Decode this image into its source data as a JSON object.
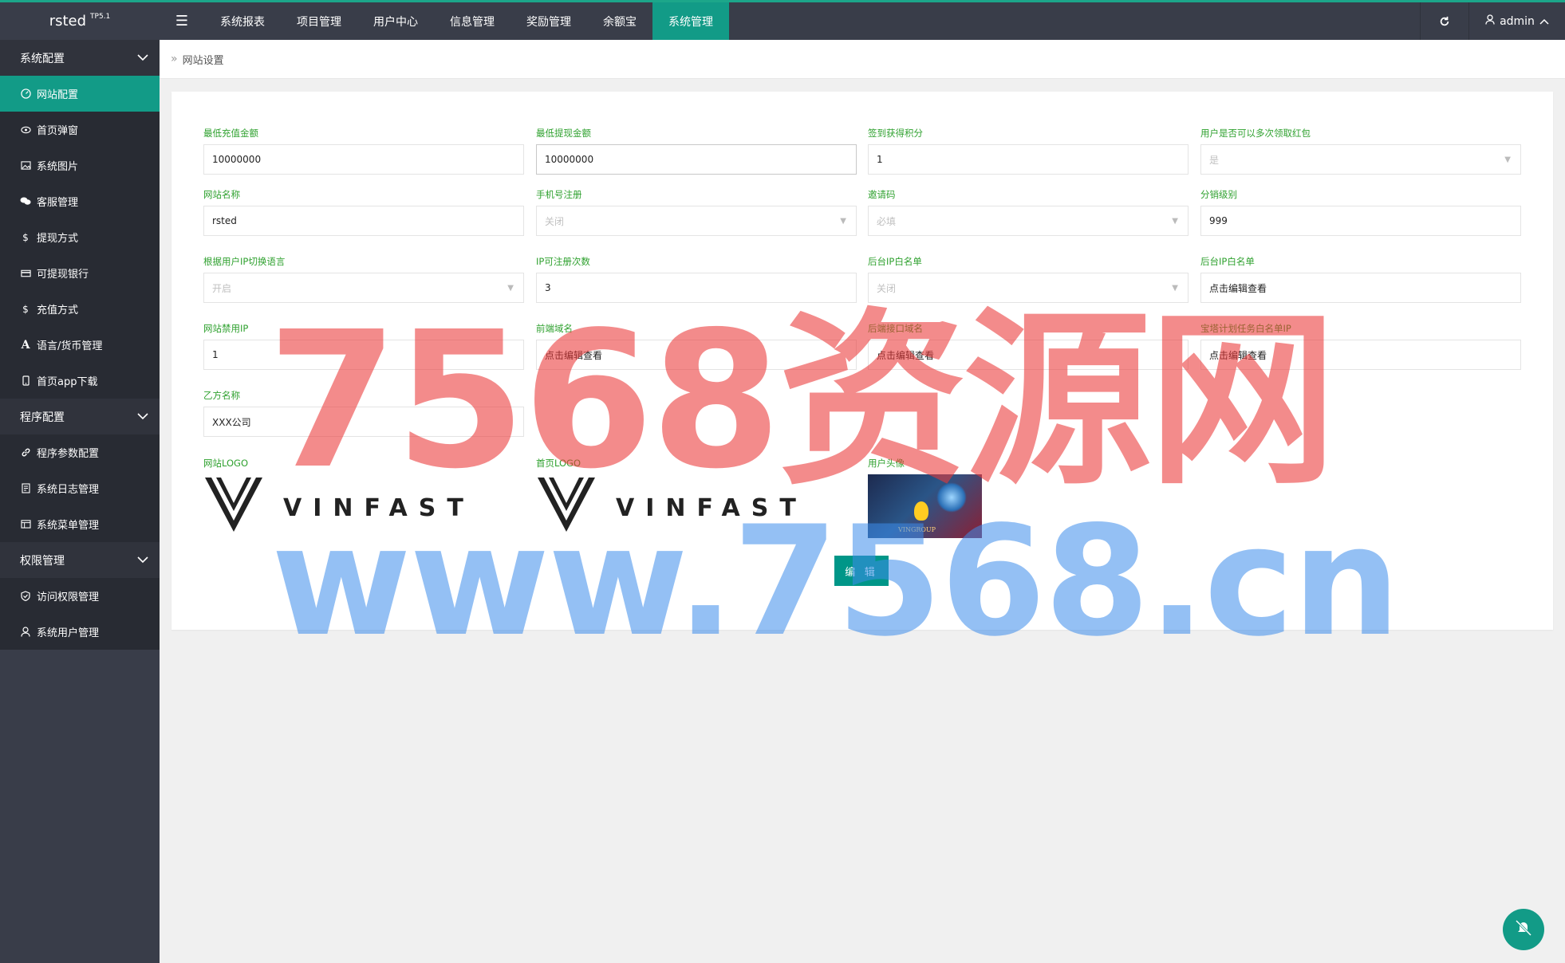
{
  "app": {
    "name": "rsted",
    "version": "TP5.1"
  },
  "topnav": {
    "items": [
      {
        "label": "系统报表",
        "active": false
      },
      {
        "label": "项目管理",
        "active": false
      },
      {
        "label": "用户中心",
        "active": false
      },
      {
        "label": "信息管理",
        "active": false
      },
      {
        "label": "奖励管理",
        "active": false
      },
      {
        "label": "余额宝",
        "active": false
      },
      {
        "label": "系统管理",
        "active": true
      }
    ],
    "user": "admin"
  },
  "sidebar": {
    "groups": [
      {
        "label": "系统配置",
        "items": [
          {
            "label": "网站配置",
            "icon": "dashboard-icon",
            "active": true
          },
          {
            "label": "首页弹窗",
            "icon": "eye-icon",
            "active": false
          },
          {
            "label": "系统图片",
            "icon": "image-icon",
            "active": false
          },
          {
            "label": "客服管理",
            "icon": "chat-icon",
            "active": false
          },
          {
            "label": "提现方式",
            "icon": "dollar-icon",
            "active": false
          },
          {
            "label": "可提现银行",
            "icon": "card-icon",
            "active": false
          },
          {
            "label": "充值方式",
            "icon": "dollar-icon",
            "active": false
          },
          {
            "label": "语言/货币管理",
            "icon": "font-icon",
            "active": false
          },
          {
            "label": "首页app下载",
            "icon": "mobile-icon",
            "active": false
          }
        ]
      },
      {
        "label": "程序配置",
        "items": [
          {
            "label": "程序参数配置",
            "icon": "link-icon",
            "active": false
          },
          {
            "label": "系统日志管理",
            "icon": "file-icon",
            "active": false
          },
          {
            "label": "系统菜单管理",
            "icon": "table-icon",
            "active": false
          }
        ]
      },
      {
        "label": "权限管理",
        "items": [
          {
            "label": "访问权限管理",
            "icon": "shield-icon",
            "active": false
          },
          {
            "label": "系统用户管理",
            "icon": "user-icon",
            "active": false
          }
        ]
      }
    ]
  },
  "breadcrumb": "网站设置",
  "form": {
    "min_recharge": {
      "label": "最低充值金额",
      "value": "10000000"
    },
    "min_withdraw": {
      "label": "最低提现金额",
      "value": "10000000"
    },
    "sign_points": {
      "label": "签到获得积分",
      "value": "1"
    },
    "multi_redpack": {
      "label": "用户是否可以多次领取红包",
      "value": "是"
    },
    "site_name": {
      "label": "网站名称",
      "value": "rsted"
    },
    "phone_register": {
      "label": "手机号注册",
      "value": "关闭"
    },
    "invite_code": {
      "label": "邀请码",
      "value": "必填"
    },
    "distribution_level": {
      "label": "分销级别",
      "value": "999"
    },
    "ip_language": {
      "label": "根据用户IP切换语言",
      "value": "开启"
    },
    "ip_register_count": {
      "label": "IP可注册次数",
      "value": "3"
    },
    "admin_ip_whitelist_toggle": {
      "label": "后台IP白名单",
      "value": "关闭"
    },
    "admin_ip_whitelist": {
      "label": "后台IP白名单",
      "value": "点击编辑查看"
    },
    "site_banned_ip": {
      "label": "网站禁用IP",
      "value": "1"
    },
    "frontend_domain": {
      "label": "前端域名",
      "value": "点击编辑查看"
    },
    "backend_api_domain": {
      "label": "后端接口域名",
      "value": "点击编辑查看"
    },
    "task_whitelist_ip": {
      "label": "宝塔计划任务白名单IP",
      "value": "点击编辑查看"
    },
    "party_b_name": {
      "label": "乙方名称",
      "value": "XXX公司"
    },
    "site_logo": {
      "label": "网站LOGO",
      "text": "VINFAST"
    },
    "home_logo": {
      "label": "首页LOGO",
      "text": "VINFAST"
    },
    "user_avatar": {
      "label": "用户头像",
      "text": "VINGROUP"
    }
  },
  "edit_button": "编 辑",
  "watermark": {
    "line1": "7568资源网",
    "line2": "www.7568.cn"
  },
  "colors": {
    "accent": "#129b87",
    "sidebar": "#393d49",
    "label_green": "#2fa12f"
  }
}
